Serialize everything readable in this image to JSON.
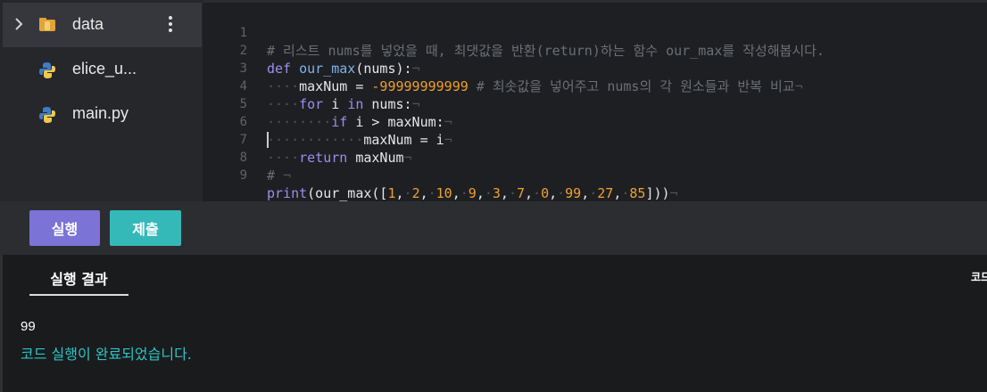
{
  "sidebar": {
    "items": [
      {
        "label": "data",
        "icon": "folder-icon",
        "active": true
      },
      {
        "label": "elice_u...",
        "icon": "python-icon"
      },
      {
        "label": "main.py",
        "icon": "python-icon"
      }
    ]
  },
  "editor": {
    "lines": [
      {
        "num": "1",
        "text": "# 리스트 nums를 넣었을 때, 최댓값을 반환(return)하는 함수 our_max를 작성해봅시다."
      },
      {
        "num": "2",
        "text": "def our_max(nums):"
      },
      {
        "num": "3",
        "text": "    maxNum = -99999999999 # 최솟값을 넣어주고 nums의 각 원소들과 반복 비교"
      },
      {
        "num": "4",
        "text": "    for i in nums:"
      },
      {
        "num": "5",
        "text": "        if i > maxNum:"
      },
      {
        "num": "6",
        "text": "            maxNum = i"
      },
      {
        "num": "7",
        "text": "    return maxNum"
      },
      {
        "num": "8",
        "text": "# "
      },
      {
        "num": "9",
        "text": "print(our_max([1, 2, 10, 9, 3, 7, 0, 99, 27, 85]))"
      }
    ],
    "tokens": {
      "l1": "# 리스트 nums를 넣었을 때, 최댓값을 반환(return)하는 함수 our_max를 작성해봅시다.",
      "l2_def": "def",
      "l2_fn": "our_max",
      "l2_rest": "(nums):",
      "l3_var": "maxNum",
      "l3_eq": " = ",
      "l3_num": "-99999999999",
      "l3_cm": " # 최솟값을 넣어주고 nums의 각 원소들과 반복 비교",
      "l4_for": "for",
      "l4_i": " i ",
      "l4_in": "in",
      "l4_rest": " nums:",
      "l5_if": "if",
      "l5_rest": " i > maxNum:",
      "l6_rest": "maxNum = i",
      "l7_ret": "return",
      "l7_rest": " maxNum",
      "l8": "# ",
      "l9_print": "print",
      "l9_a": "(our_max([",
      "l9_n1": "1",
      "l9_n2": "2",
      "l9_n3": "10",
      "l9_n4": "9",
      "l9_n5": "3",
      "l9_n6": "7",
      "l9_n7": "0",
      "l9_n8": "99",
      "l9_n9": "27",
      "l9_n10": "85",
      "l9_end": "]))"
    }
  },
  "buttons": {
    "run": "실행",
    "submit": "제출"
  },
  "output": {
    "tab_label": "실행 결과",
    "tab_right": "코드",
    "result": "99",
    "status": "코드 실행이 완료되었습니다."
  }
}
